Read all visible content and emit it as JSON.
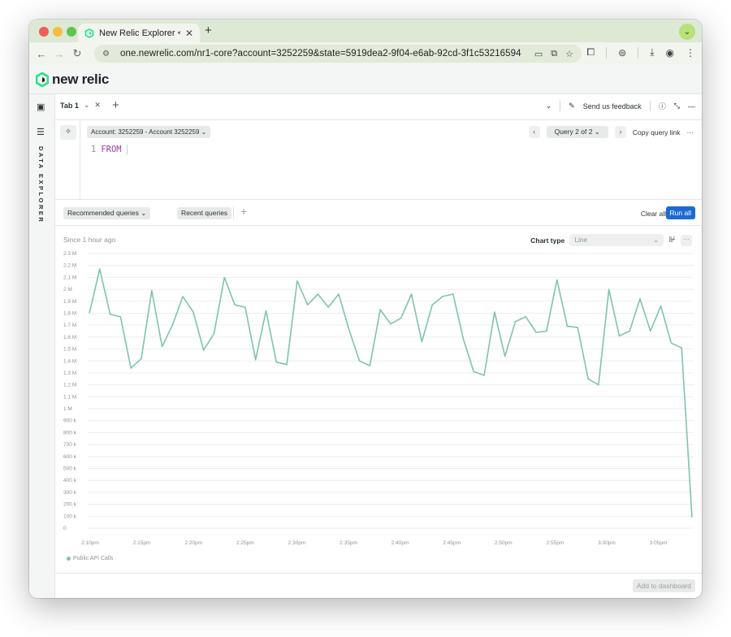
{
  "browser": {
    "tab_title": "New Relic Explorer < New Rel",
    "url": "one.newrelic.com/nr1-core?account=3252259&state=5919dea2-9f04-e6ab-92cd-3f1c53216594",
    "newtab": "+",
    "tab_close": "✕"
  },
  "app": {
    "logo_text": "new relic"
  },
  "rail": {
    "vertical_label": "DATA EXPLORER"
  },
  "explorer_tabs": {
    "tab_label": "Tab 1",
    "feedback": "Send us feedback",
    "add": "+"
  },
  "query": {
    "account": "Account: 3252259 - Account 3252259 ⌄",
    "line_number": "1",
    "keyword": "FROM",
    "query_select": "Query 2 of 2 ⌄",
    "copy_link": "Copy query link",
    "more": "···"
  },
  "actions": {
    "recommended": "Recommended queries ⌄",
    "recent": "Recent queries",
    "clear": "Clear all",
    "run": "Run all",
    "add_to_dashboard": "Add to dashboard"
  },
  "chart_panel": {
    "since": "Since 1 hour ago",
    "chart_type_label": "Chart type",
    "chart_type_value": "Line"
  },
  "chart_data": {
    "type": "line",
    "ylim": [
      0,
      2300000
    ],
    "yticks": [
      "0",
      "100 k",
      "200 k",
      "300 k",
      "400 k",
      "500 k",
      "600 k",
      "700 k",
      "800 k",
      "900 k",
      "1 M",
      "1.1 M",
      "1.2 M",
      "1.3 M",
      "1.4 M",
      "1.5 M",
      "1.6 M",
      "1.7 M",
      "1.8 M",
      "1.9 M",
      "2 M",
      "2.1 M",
      "2.2 M",
      "2.3 M"
    ],
    "xticks": [
      "2:10pm",
      "2:15pm",
      "2:20pm",
      "2:25pm",
      "2:30pm",
      "2:35pm",
      "2:40pm",
      "2:45pm",
      "2:50pm",
      "2:55pm",
      "3:00pm",
      "3:05pm"
    ],
    "grid": true,
    "legend_position": "bottom-left",
    "series": [
      {
        "name": "Public API Calls",
        "color": "#7ec4ac",
        "values": [
          1800000,
          2170000,
          1790000,
          1770000,
          1340000,
          1420000,
          1990000,
          1520000,
          1700000,
          1940000,
          1810000,
          1490000,
          1630000,
          2100000,
          1870000,
          1850000,
          1410000,
          1820000,
          1390000,
          1370000,
          2070000,
          1870000,
          1960000,
          1850000,
          1960000,
          1660000,
          1400000,
          1360000,
          1830000,
          1710000,
          1760000,
          1960000,
          1560000,
          1870000,
          1940000,
          1960000,
          1580000,
          1310000,
          1280000,
          1810000,
          1440000,
          1730000,
          1770000,
          1640000,
          1650000,
          2080000,
          1690000,
          1680000,
          1250000,
          1200000,
          2000000,
          1610000,
          1650000,
          1920000,
          1650000,
          1860000,
          1550000,
          1510000,
          90000
        ]
      }
    ]
  }
}
